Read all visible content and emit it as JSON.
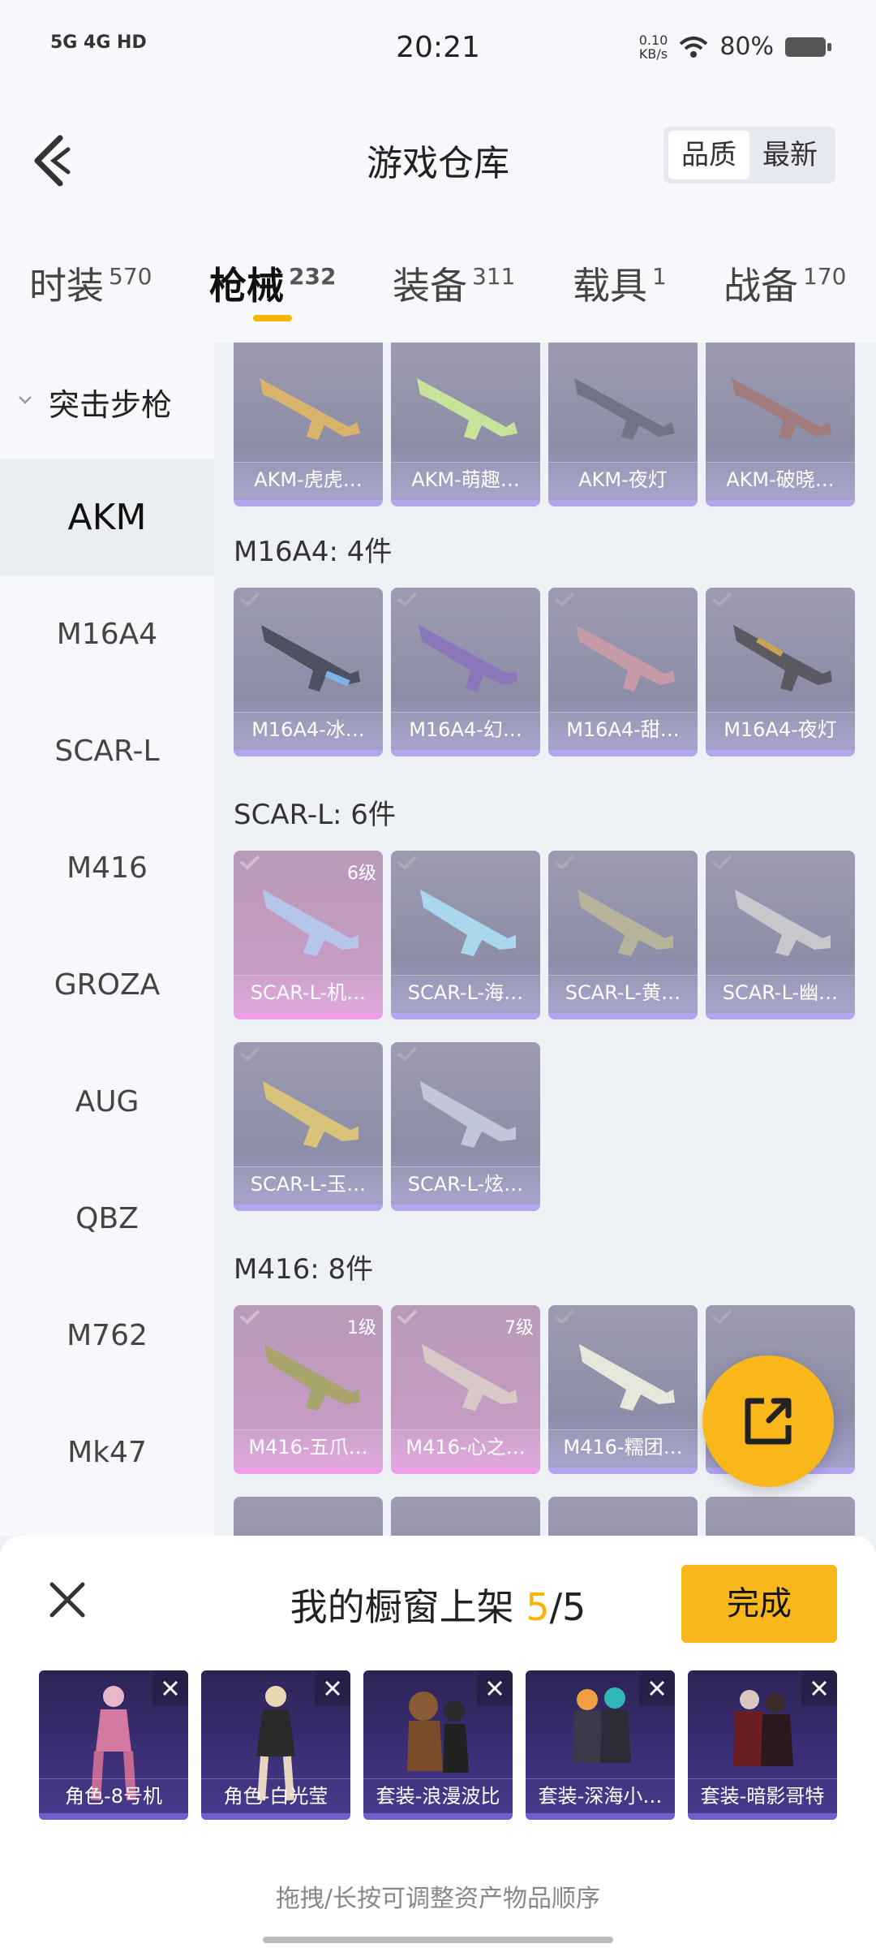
{
  "status": {
    "signal": "5G 4G HD",
    "time": "20:21",
    "speed_value": "0.10",
    "speed_unit": "KB/s",
    "battery": "80%"
  },
  "header": {
    "title": "游戏仓库",
    "sort_quality": "品质",
    "sort_latest": "最新"
  },
  "tabs": [
    {
      "label": "时装",
      "count": "570"
    },
    {
      "label": "枪械",
      "count": "232"
    },
    {
      "label": "装备",
      "count": "311"
    },
    {
      "label": "载具",
      "count": "1"
    },
    {
      "label": "战备",
      "count": "170"
    }
  ],
  "sidebar": {
    "group": "突击步枪",
    "items": [
      "AKM",
      "M16A4",
      "SCAR-L",
      "M416",
      "GROZA",
      "AUG",
      "QBZ",
      "M762",
      "Mk47"
    ]
  },
  "sections": {
    "m16": "M16A4: 4件",
    "scar": "SCAR-L: 6件",
    "m416": "M416: 8件"
  },
  "akm_cards": [
    "AKM-虎虎…",
    "AKM-萌趣…",
    "AKM-夜灯",
    "AKM-破晓…"
  ],
  "m16_cards": [
    "M16A4-冰…",
    "M16A4-幻…",
    "M16A4-甜…",
    "M16A4-夜灯"
  ],
  "scar_cards": [
    "SCAR-L-机…",
    "SCAR-L-海…",
    "SCAR-L-黄…",
    "SCAR-L-幽…",
    "SCAR-L-玉…",
    "SCAR-L-炫…"
  ],
  "scar_level": "6级",
  "m416_cards": [
    "M416-五爪…",
    "M416-心之…",
    "M416-糯团…"
  ],
  "m416_levels": [
    "1级",
    "7级"
  ],
  "sheet": {
    "title_prefix": "我的橱窗上架",
    "count_current": "5",
    "count_total": "/5",
    "done_label": "完成",
    "hint": "拖拽/长按可调整资产物品顺序",
    "slots": [
      "角色-8号机",
      "角色-白光莹",
      "套装-浪漫波比",
      "套装-深海小…",
      "套装-暗影哥特"
    ]
  },
  "colors": {
    "accent": "#f5b400",
    "card": "#9c9bb0",
    "card_pink": "#c79bc4"
  }
}
